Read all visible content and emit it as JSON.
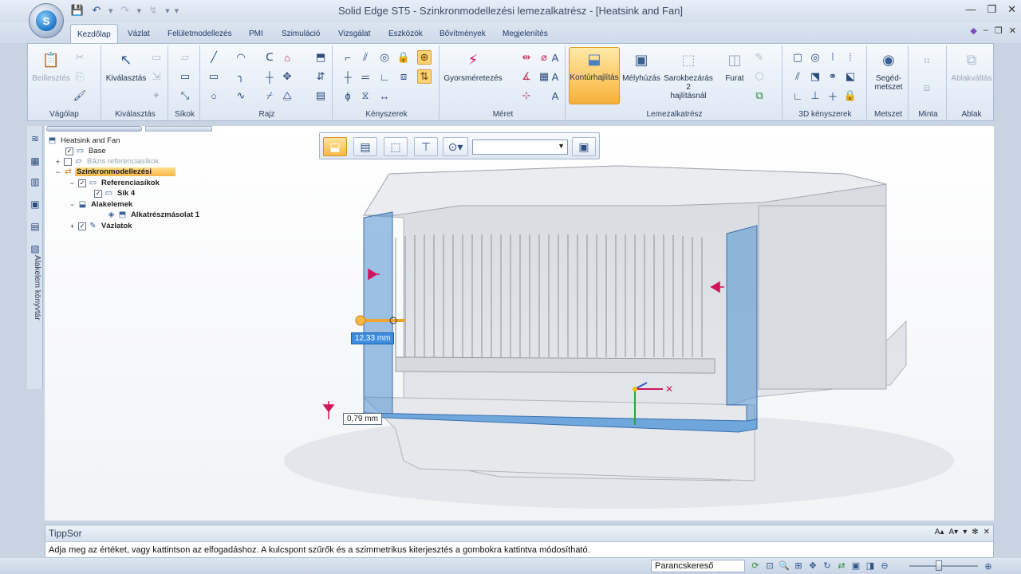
{
  "window": {
    "title": "Solid Edge ST5 - Szinkronmodellezési lemezalkatrész - [Heatsink and Fan]",
    "app_logo_letter": "S"
  },
  "tabs": [
    "Kezdőlap",
    "Vázlat",
    "Felületmodellezés",
    "PMI",
    "Szimuláció",
    "Vizsgálat",
    "Eszközök",
    "Bővítmények",
    "Megjelenítés"
  ],
  "active_tab": "Kezdőlap",
  "ribbon": {
    "vagolap": {
      "label": "Vágólap",
      "paste": "Beillesztés"
    },
    "kivalasztas": {
      "label": "Kiválasztás",
      "select": "Kiválasztás"
    },
    "sikok": {
      "label": "Síkok"
    },
    "rajz": {
      "label": "Rajz"
    },
    "kenyszerek": {
      "label": "Kényszerek"
    },
    "meret": {
      "label": "Méret",
      "smart": "Gyorsméretezés"
    },
    "lemez": {
      "label": "Lemezalkatrész",
      "contour": "Kontúrhajlítás",
      "deep": "Mélyhúzás",
      "corner1": "Sarokbezárás 2",
      "corner2": "hajlításnál",
      "hole": "Furat"
    },
    "k3d": {
      "label": "3D kényszerek"
    },
    "metszet": {
      "label": "Metszet",
      "b1": "Segéd-",
      "b2": "metszet"
    },
    "minta": {
      "label": "Minta"
    },
    "ablak": {
      "label": "Ablak",
      "switch": "Ablakváltás"
    }
  },
  "pathfinder": {
    "nodes": [
      {
        "label": "Heatsink and Fan"
      },
      {
        "label": "Base"
      },
      {
        "label": "Bázis referenciasíkok"
      },
      {
        "label": "Szinkronmodellezési"
      },
      {
        "label": "Referenciasíkok"
      },
      {
        "label": "Sík 4"
      },
      {
        "label": "Alakelemek"
      },
      {
        "label": "Alkatrészmásolat 1"
      },
      {
        "label": "Vázlatok"
      }
    ]
  },
  "left_strip_label": "Alakelem könyvtár",
  "dimensions": {
    "edit_value": "12,33 mm",
    "static_value": "0,79 mm"
  },
  "tippsor": {
    "title": "TippSor",
    "text": "Adja meg az értéket, vagy kattintson az elfogadáshoz. A kulcspont szűrők és a szimmetrikus kiterjesztés a gombokra kattintva módosítható."
  },
  "statusbar": {
    "command_finder": "Parancskereső"
  },
  "colors": {
    "accent": "#f7b748",
    "panel_blue": "#4f8fd0",
    "dim_red": "#d0155c"
  }
}
